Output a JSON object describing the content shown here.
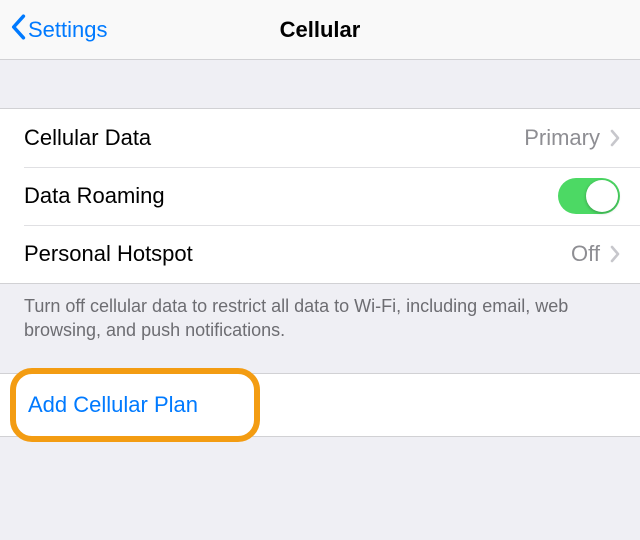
{
  "navbar": {
    "back_label": "Settings",
    "title": "Cellular"
  },
  "rows": {
    "cellularData": {
      "label": "Cellular Data",
      "value": "Primary"
    },
    "dataRoaming": {
      "label": "Data Roaming"
    },
    "personalHotspot": {
      "label": "Personal Hotspot",
      "value": "Off"
    }
  },
  "footer_note": "Turn off cellular data to restrict all data to Wi-Fi, including email, web browsing, and push notifications.",
  "actions": {
    "addCellularPlan": "Add Cellular Plan"
  }
}
